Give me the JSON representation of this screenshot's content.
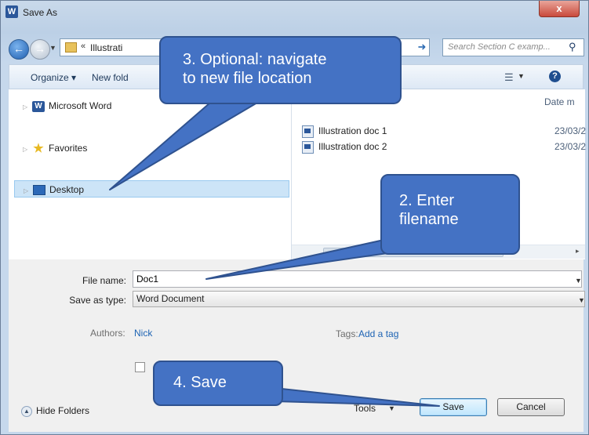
{
  "window": {
    "title": "Save As",
    "app_icon": "W",
    "close_label": "x"
  },
  "address_bar": {
    "separator": "«",
    "path": "Illustrati",
    "refresh_icon": "refresh-icon"
  },
  "search": {
    "placeholder": "Search Section C examp..."
  },
  "toolbar": {
    "organize": "Organize ▾",
    "new_folder": "New fold"
  },
  "nav_pane": {
    "items": [
      {
        "label": "Microsoft Word",
        "icon": "word-icon"
      },
      {
        "label": "Favorites",
        "icon": "star-icon"
      },
      {
        "label": "Desktop",
        "icon": "desktop-icon",
        "selected": true
      }
    ]
  },
  "file_list": {
    "columns": [
      "Date m"
    ],
    "files": [
      {
        "name": "Illustration doc 1",
        "date": "23/03/2"
      },
      {
        "name": "Illustration doc 2",
        "date": "23/03/2"
      }
    ],
    "scroll_thumb_label": "III"
  },
  "form": {
    "filename_label": "File name:",
    "filename_value": "Doc1",
    "savetype_label": "Save as type:",
    "savetype_value": "Word Document",
    "authors_label": "Authors:",
    "authors_value": "Nick",
    "tags_label": "Tags:",
    "tags_value": "Add a tag",
    "thumbnail_label": ""
  },
  "footer": {
    "hide_folders": "Hide Folders",
    "tools": "Tools",
    "save": "Save",
    "cancel": "Cancel"
  },
  "callouts": {
    "step3_line1": "3. Optional: navigate",
    "step3_line2": "to new file location",
    "step2_line1": "2. Enter",
    "step2_line2": "filename",
    "step4": "4. Save"
  },
  "colors": {
    "callout_fill": "#4472c4",
    "callout_border": "#2f528f",
    "selection": "#cce4f7",
    "link": "#1e64b4"
  }
}
